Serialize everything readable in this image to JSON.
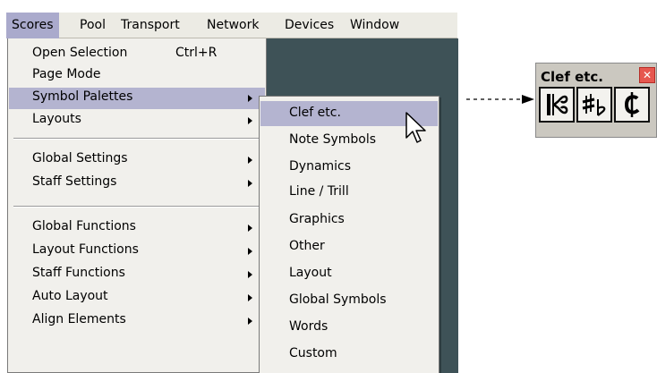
{
  "menubar": {
    "items": [
      "Scores",
      "Pool",
      "Transport",
      "Network",
      "Devices",
      "Window"
    ],
    "active_index": 0
  },
  "scores_menu": {
    "items": [
      {
        "label": "Open Selection",
        "shortcut": "Ctrl+R",
        "submenu": false
      },
      {
        "label": "Page Mode",
        "submenu": false
      },
      {
        "label": "Symbol Palettes",
        "submenu": true,
        "highlighted": true
      },
      {
        "label": "Layouts",
        "submenu": true
      },
      {
        "label": "Global Settings",
        "submenu": true
      },
      {
        "label": "Staff Settings",
        "submenu": true
      },
      {
        "label": "Global Functions",
        "submenu": true
      },
      {
        "label": "Layout Functions",
        "submenu": true
      },
      {
        "label": "Staff Functions",
        "submenu": true
      },
      {
        "label": "Auto Layout",
        "submenu": true
      },
      {
        "label": "Align Elements",
        "submenu": true
      }
    ]
  },
  "palettes_menu": {
    "items": [
      "Clef etc.",
      "Note Symbols",
      "Dynamics",
      "Line / Trill",
      "Graphics",
      "Other",
      "Layout",
      "Global Symbols",
      "Words",
      "Custom"
    ],
    "highlighted_index": 0
  },
  "palette_window": {
    "title": "Clef etc.",
    "close_icon": "close-icon",
    "buttons": [
      "alto-clef-icon",
      "sharp-flat-icon",
      "cut-time-icon"
    ]
  },
  "colors": {
    "menubar_bg": "#ecebe4",
    "menu_bg": "#f1f0ec",
    "highlight": "#b4b4d0",
    "app_bg": "#3e5257",
    "palette_bg": "#cbc8c0",
    "close_red": "#e6574f"
  }
}
